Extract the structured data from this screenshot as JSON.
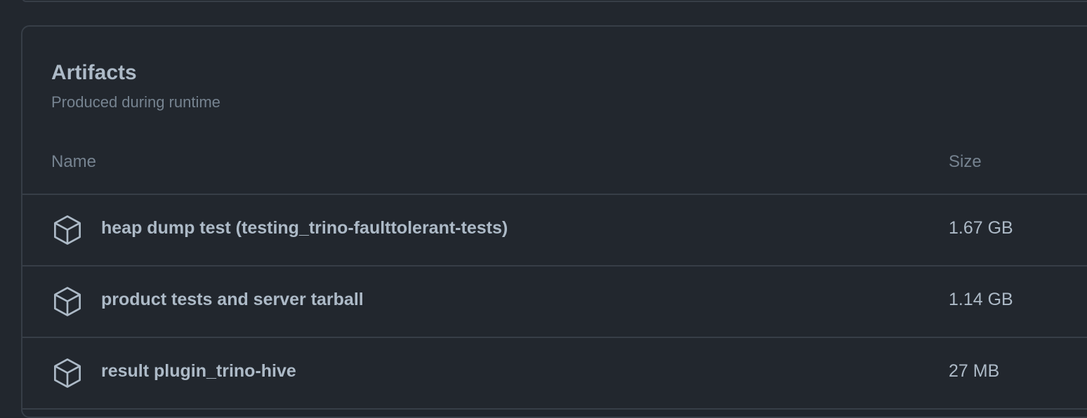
{
  "artifacts_section": {
    "title": "Artifacts",
    "subtitle": "Produced during runtime",
    "columns": {
      "name": "Name",
      "size": "Size"
    },
    "items": [
      {
        "name": "heap dump test (testing_trino-faulttolerant-tests)",
        "size": "1.67 GB",
        "icon": "package-icon"
      },
      {
        "name": "product tests and server tarball",
        "size": "1.14 GB",
        "icon": "package-icon"
      },
      {
        "name": "result plugin_trino-hive",
        "size": "27 MB",
        "icon": "package-icon"
      }
    ]
  },
  "colors": {
    "background": "#22272e",
    "border": "#373e47",
    "text_primary": "#adbac7",
    "text_muted": "#768390"
  }
}
